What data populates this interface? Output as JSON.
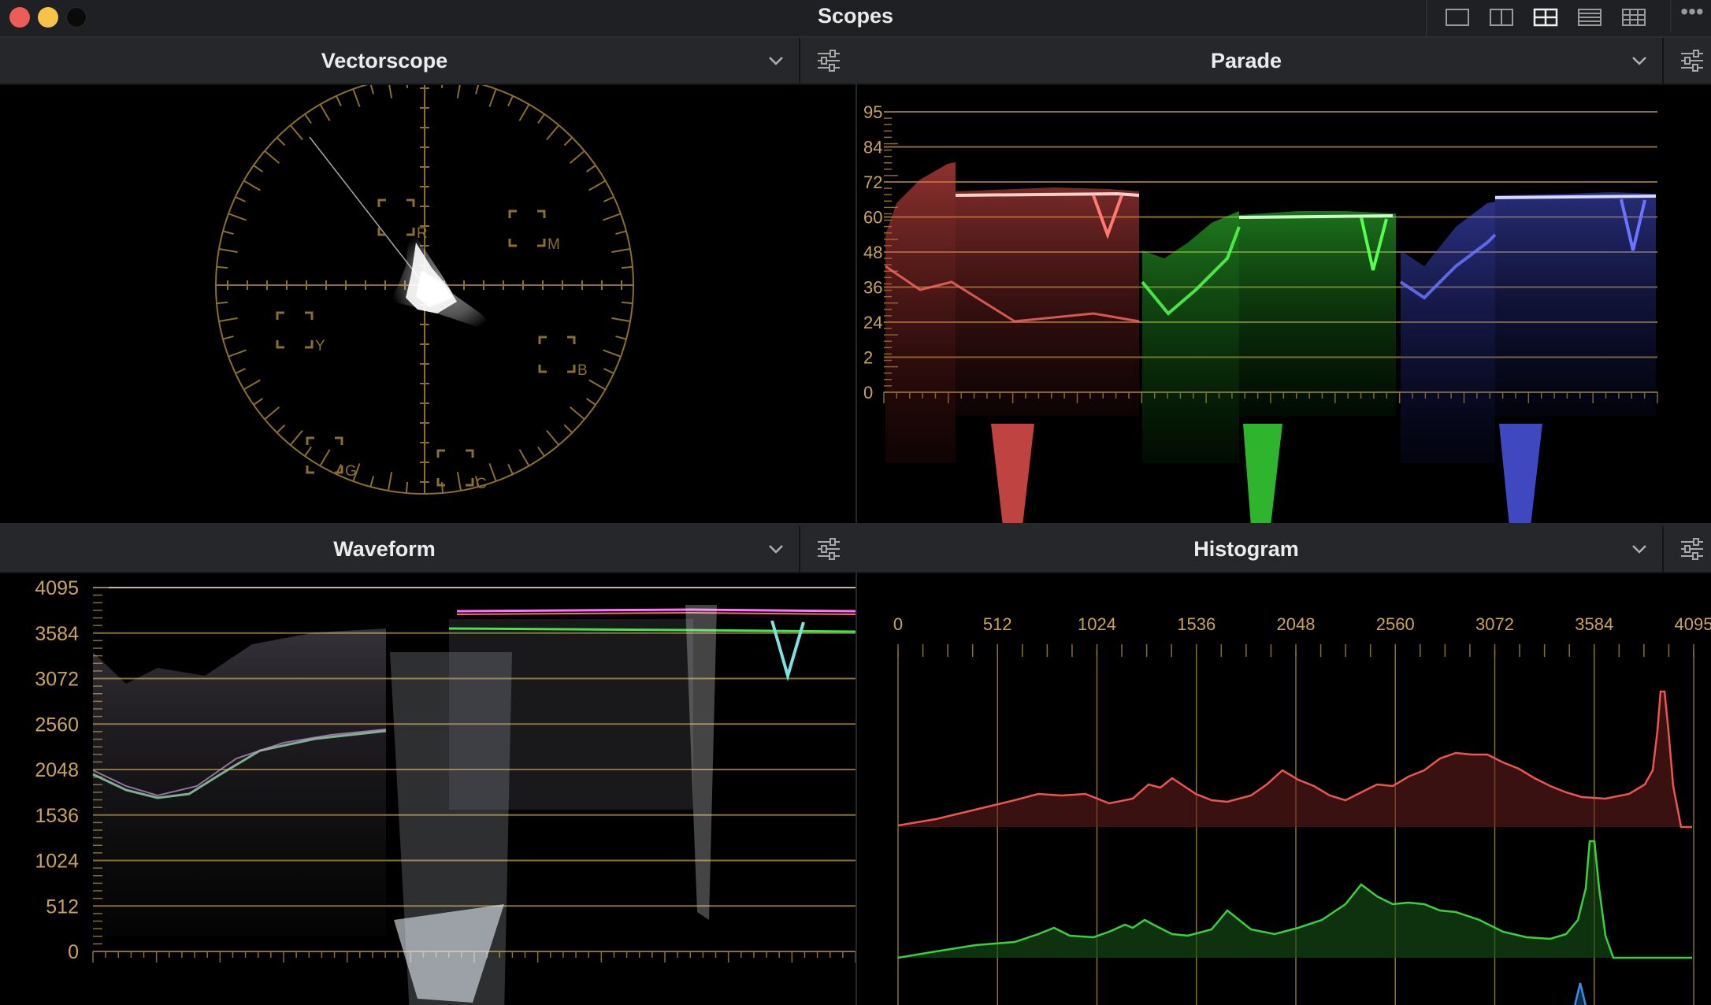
{
  "window": {
    "title": "Scopes"
  },
  "layout_buttons": [
    "single-view-icon",
    "two-up-view-icon",
    "quad-view-icon",
    "stacked-view-icon",
    "grid-view-icon"
  ],
  "panels": {
    "vectorscope": {
      "title": "Vectorscope",
      "targets": [
        "R",
        "M",
        "Y",
        "B",
        "G",
        "C"
      ]
    },
    "parade": {
      "title": "Parade",
      "y_labels": [
        "0",
        "2",
        "24",
        "36",
        "48",
        "60",
        "72",
        "84",
        "95"
      ]
    },
    "waveform": {
      "title": "Waveform",
      "y_labels": [
        "0",
        "512",
        "1024",
        "1536",
        "2048",
        "2560",
        "3072",
        "3584",
        "4095"
      ]
    },
    "histogram": {
      "title": "Histogram",
      "x_labels": [
        "0",
        "512",
        "1024",
        "1536",
        "2048",
        "2560",
        "3072",
        "3584",
        "4095"
      ]
    }
  },
  "colors": {
    "scope_gold": "#8a6f2e",
    "label_gold": "#c9a35a",
    "red": "#e0504a",
    "green": "#38d13a",
    "blue": "#4e57e8",
    "panel_header": "#26272b"
  }
}
